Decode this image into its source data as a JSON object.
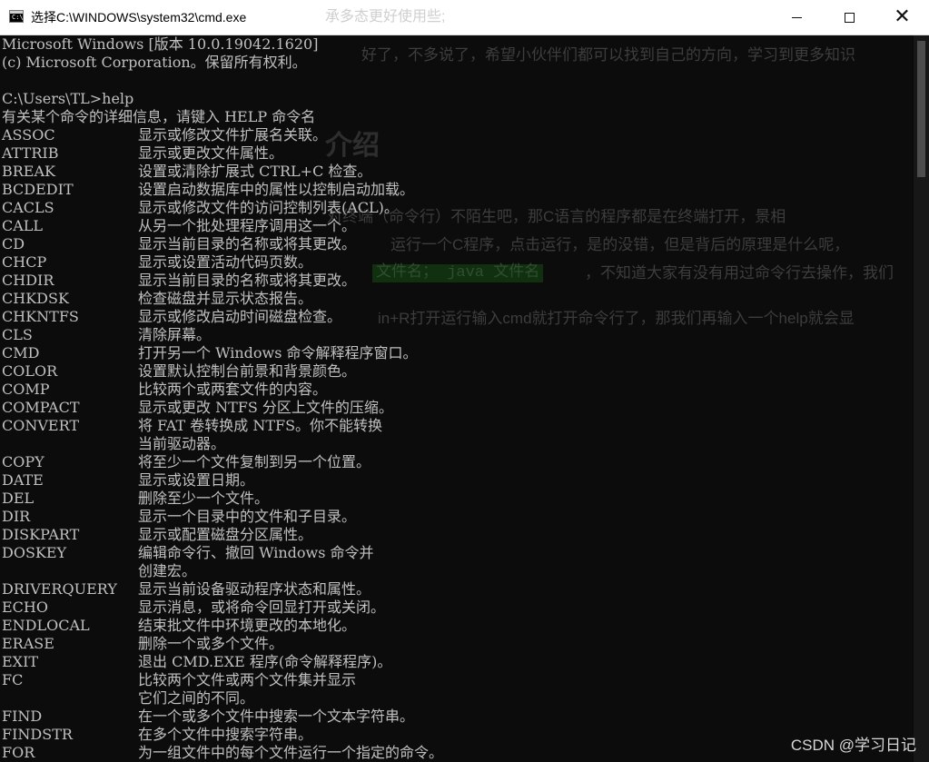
{
  "window": {
    "title": "选择C:\\WINDOWS\\system32\\cmd.exe",
    "bg_overlay_text": "承多态更好使用些;",
    "icon_label": "C:\\",
    "controls": {
      "minimize": "minimize",
      "maximize": "maximize",
      "close": "✕"
    }
  },
  "console": {
    "header_lines": [
      "Microsoft Windows [版本 10.0.19042.1620]",
      "(c) Microsoft Corporation。保留所有权利。"
    ],
    "prompt": "C:\\Users\\TL>help",
    "help_intro": "有关某个命令的详细信息，请键入 HELP 命令名",
    "commands": [
      {
        "name": "ASSOC",
        "desc": "显示或修改文件扩展名关联。"
      },
      {
        "name": "ATTRIB",
        "desc": "显示或更改文件属性。"
      },
      {
        "name": "BREAK",
        "desc": "设置或清除扩展式 CTRL+C 检查。"
      },
      {
        "name": "BCDEDIT",
        "desc": "设置启动数据库中的属性以控制启动加载。"
      },
      {
        "name": "CACLS",
        "desc": "显示或修改文件的访问控制列表(ACL)。"
      },
      {
        "name": "CALL",
        "desc": "从另一个批处理程序调用这一个。"
      },
      {
        "name": "CD",
        "desc": "显示当前目录的名称或将其更改。"
      },
      {
        "name": "CHCP",
        "desc": "显示或设置活动代码页数。"
      },
      {
        "name": "CHDIR",
        "desc": "显示当前目录的名称或将其更改。"
      },
      {
        "name": "CHKDSK",
        "desc": "检查磁盘并显示状态报告。"
      },
      {
        "name": "CHKNTFS",
        "desc": "显示或修改启动时间磁盘检查。"
      },
      {
        "name": "CLS",
        "desc": "清除屏幕。"
      },
      {
        "name": "CMD",
        "desc": "打开另一个 Windows 命令解释程序窗口。"
      },
      {
        "name": "COLOR",
        "desc": "设置默认控制台前景和背景颜色。"
      },
      {
        "name": "COMP",
        "desc": "比较两个或两套文件的内容。"
      },
      {
        "name": "COMPACT",
        "desc": "显示或更改 NTFS 分区上文件的压缩。"
      },
      {
        "name": "CONVERT",
        "desc": "将 FAT 卷转换成 NTFS。你不能转换"
      },
      {
        "name": "",
        "desc": "当前驱动器。"
      },
      {
        "name": "COPY",
        "desc": "将至少一个文件复制到另一个位置。"
      },
      {
        "name": "DATE",
        "desc": "显示或设置日期。"
      },
      {
        "name": "DEL",
        "desc": "删除至少一个文件。"
      },
      {
        "name": "DIR",
        "desc": "显示一个目录中的文件和子目录。"
      },
      {
        "name": "DISKPART",
        "desc": "显示或配置磁盘分区属性。"
      },
      {
        "name": "DOSKEY",
        "desc": "编辑命令行、撤回 Windows 命令并"
      },
      {
        "name": "",
        "desc": "创建宏。"
      },
      {
        "name": "DRIVERQUERY",
        "desc": "显示当前设备驱动程序状态和属性。"
      },
      {
        "name": "ECHO",
        "desc": "显示消息，或将命令回显打开或关闭。"
      },
      {
        "name": "ENDLOCAL",
        "desc": "结束批文件中环境更改的本地化。"
      },
      {
        "name": "ERASE",
        "desc": "删除一个或多个文件。"
      },
      {
        "name": "EXIT",
        "desc": "退出 CMD.EXE 程序(命令解释程序)。"
      },
      {
        "name": "FC",
        "desc": "比较两个文件或两个文件集并显示"
      },
      {
        "name": "",
        "desc": "它们之间的不同。"
      },
      {
        "name": "FIND",
        "desc": "在一个或多个文件中搜索一个文本字符串。"
      },
      {
        "name": "FINDSTR",
        "desc": "在多个文件中搜索字符串。"
      },
      {
        "name": "FOR",
        "desc": "为一组文件中的每个文件运行一个指定的命令。"
      }
    ]
  },
  "background_article": {
    "line1": "好了，不多说了，希望小伙伴们都可以找到自己的方向，学习到更多知识",
    "heading": "介绍",
    "line2": "对终端（命令行）不陌生吧，那C语言的程序都是在终端打开，景相",
    "line3": "运行一个C程序，点击运行，是的没错，但是背后的原理是什么呢，",
    "code": "文件名； java 文件名",
    "line4": "，不知道大家有没有用过命令行去操作，我们",
    "line5": "in+R打开运行输入cmd就打开命令行了，那我们再输入一个help就会显"
  },
  "watermark": "CSDN @学习日记"
}
